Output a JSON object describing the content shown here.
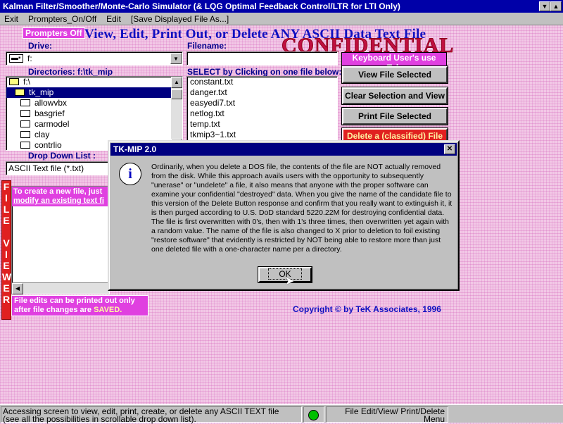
{
  "window": {
    "title": "Kalman Filter/Smoother/Monte-Carlo Simulator (& LQG Optimal Feedback Control/LTR for LTI Only)"
  },
  "menu": {
    "items": [
      {
        "label": "Exit"
      },
      {
        "label": "Prompters_On/Off"
      },
      {
        "label": "Edit"
      },
      {
        "label": "[Save Displayed File As...]"
      }
    ]
  },
  "prompters_badge": "Prompters Off",
  "heading": "View, Edit, Print Out, or Delete ANY ASCII Data Text File",
  "confidential": "CONFIDENTIAL",
  "drive": {
    "label": "Drive:",
    "value": "f:"
  },
  "filename": {
    "label": "Filename:",
    "value": ""
  },
  "keyboard_note": "Keyboard User's use Tab",
  "directories": {
    "label": "Directories: f:\\tk_mip",
    "items": [
      {
        "label": "f:\\",
        "selected": false
      },
      {
        "label": "tk_mip",
        "selected": true
      },
      {
        "label": "allowvbx",
        "selected": false
      },
      {
        "label": "basgrief",
        "selected": false
      },
      {
        "label": "carmodel",
        "selected": false
      },
      {
        "label": "clay",
        "selected": false
      },
      {
        "label": "contrlio",
        "selected": false
      }
    ]
  },
  "select_label": "SELECT by Clicking on one file below:",
  "files": [
    "constant.txt",
    "danger.txt",
    "easyedi7.txt",
    "netlog.txt",
    "temp.txt",
    "tkmip3~1.txt"
  ],
  "buttons": {
    "view": "View File Selected",
    "clear": "Clear Selection and View",
    "print": "Print File Selected",
    "delete": "Delete a (classified) File"
  },
  "dropdown_list": {
    "label": "Drop Down List :",
    "value": "ASCII Text file (*.txt)"
  },
  "create_note": {
    "line1": "To create a new file, just",
    "line2": "modify an existing text fi"
  },
  "file_viewer_letters": [
    "F",
    "I",
    "L",
    "E",
    "",
    "V",
    "I",
    "E",
    "W",
    "E",
    "R"
  ],
  "print_note": {
    "line1": "File edits can be printed out only",
    "line2_prefix": "after  file changes are ",
    "line2_highlight": "SAVED."
  },
  "copyright": "Copyright © by TeK Associates, 1996",
  "dialog": {
    "title": "TK-MIP 2.0",
    "message": "Ordinarily, when you delete a DOS file, the contents of the file are NOT actually removed from the disk. While this approach avails users with the opportunity to subsequently \"unerase\" or \"undelete\" a file, it also means that anyone with the proper software can examine your confidential \"destroyed\" data. When you give the name of the candidate file to this version of the Delete Button response and confirm that you really want to extinguish it, it is then purged according to U.S. DoD standard 5220.22M for destroying confidential data. The file is first overwritten with 0's, then with 1's three times, then overwritten yet again with a random value. The name of the file is also changed to X prior to deletion to foil existing \"restore software\" that evidently is restricted by NOT being able to restore more than just one deleted file with a one-character name per a directory.",
    "ok": "OK"
  },
  "status": {
    "left_line1": "Accessing screen to view, edit, print, create, or delete any ASCII TEXT file",
    "left_line2": "(see all the possibilities in scrollable drop down list).",
    "right_line1": "File Edit/View/ Print/Delete",
    "right_line2": "Menu",
    "indicator_color": "#00c000"
  }
}
